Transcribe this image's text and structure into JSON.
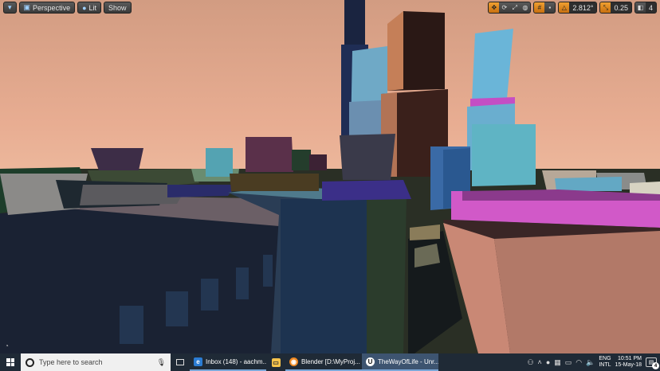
{
  "viewport": {
    "left_toolbar": {
      "perspective_label": "Perspective",
      "lit_label": "Lit",
      "show_label": "Show"
    },
    "right_toolbar": {
      "rotation_snap_value": "2.812°",
      "scale_snap_value": "0.25",
      "camera_speed_value": "4"
    }
  },
  "taskbar": {
    "search_placeholder": "Type here to search",
    "apps": [
      {
        "label": "Inbox (148) - aachm...",
        "icon": "mail-icon",
        "color": "#2b7cd3"
      },
      {
        "label": "",
        "icon": "file-explorer-icon",
        "color": "#f5c34b"
      },
      {
        "label": "Blender [D:\\MyProj...",
        "icon": "blender-icon",
        "color": "#f08a24"
      },
      {
        "label": "TheWayOfLife - Unr...",
        "icon": "unreal-icon",
        "color": "#ffffff"
      }
    ],
    "tray": {
      "lang_top": "ENG",
      "lang_bottom": "INTL",
      "time": "10:51 PM",
      "date": "15-May-18",
      "notification_count": "4"
    }
  }
}
